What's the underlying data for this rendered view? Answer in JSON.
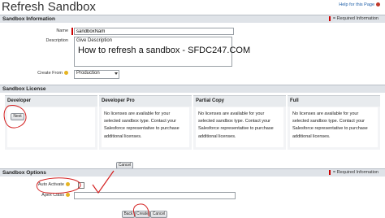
{
  "page": {
    "title": "Refresh Sandbox",
    "help_label": "Help for this Page"
  },
  "sandbox_information": {
    "section_title": "Sandbox Information",
    "required_note": "= Required Information",
    "name_label": "Name",
    "name_value": "sandboxNam",
    "description_label": "Description",
    "description_value": "Give Description",
    "create_from_label": "Create From",
    "create_from_value": "Production"
  },
  "watermark": "How to refresh a sandbox - SFDC247.COM",
  "sandbox_license": {
    "section_title": "Sandbox License",
    "columns": [
      {
        "title": "Developer",
        "text": "",
        "button": "Next"
      },
      {
        "title": "Developer Pro",
        "text": "No licenses are available for your selected sandbox type. Contact your Salesforce representative to purchase additional licenses."
      },
      {
        "title": "Partial Copy",
        "text": "No licenses are available for your selected sandbox type. Contact your Salesforce representative to purchase additional licenses."
      },
      {
        "title": "Full",
        "text": "No licenses are available for your selected sandbox type. Contact your Salesforce representative to purchase additional licenses."
      }
    ]
  },
  "sandbox_options": {
    "section_title": "Sandbox Options",
    "required_note": "= Required Information",
    "cancel_label": "Cancel",
    "auto_activate_label": "Auto Activate",
    "apex_class_label": "Apex Class"
  },
  "footer_buttons": {
    "back": "Back",
    "create": "Create",
    "cancel": "Cancel"
  },
  "annotation_color": "#d42020"
}
